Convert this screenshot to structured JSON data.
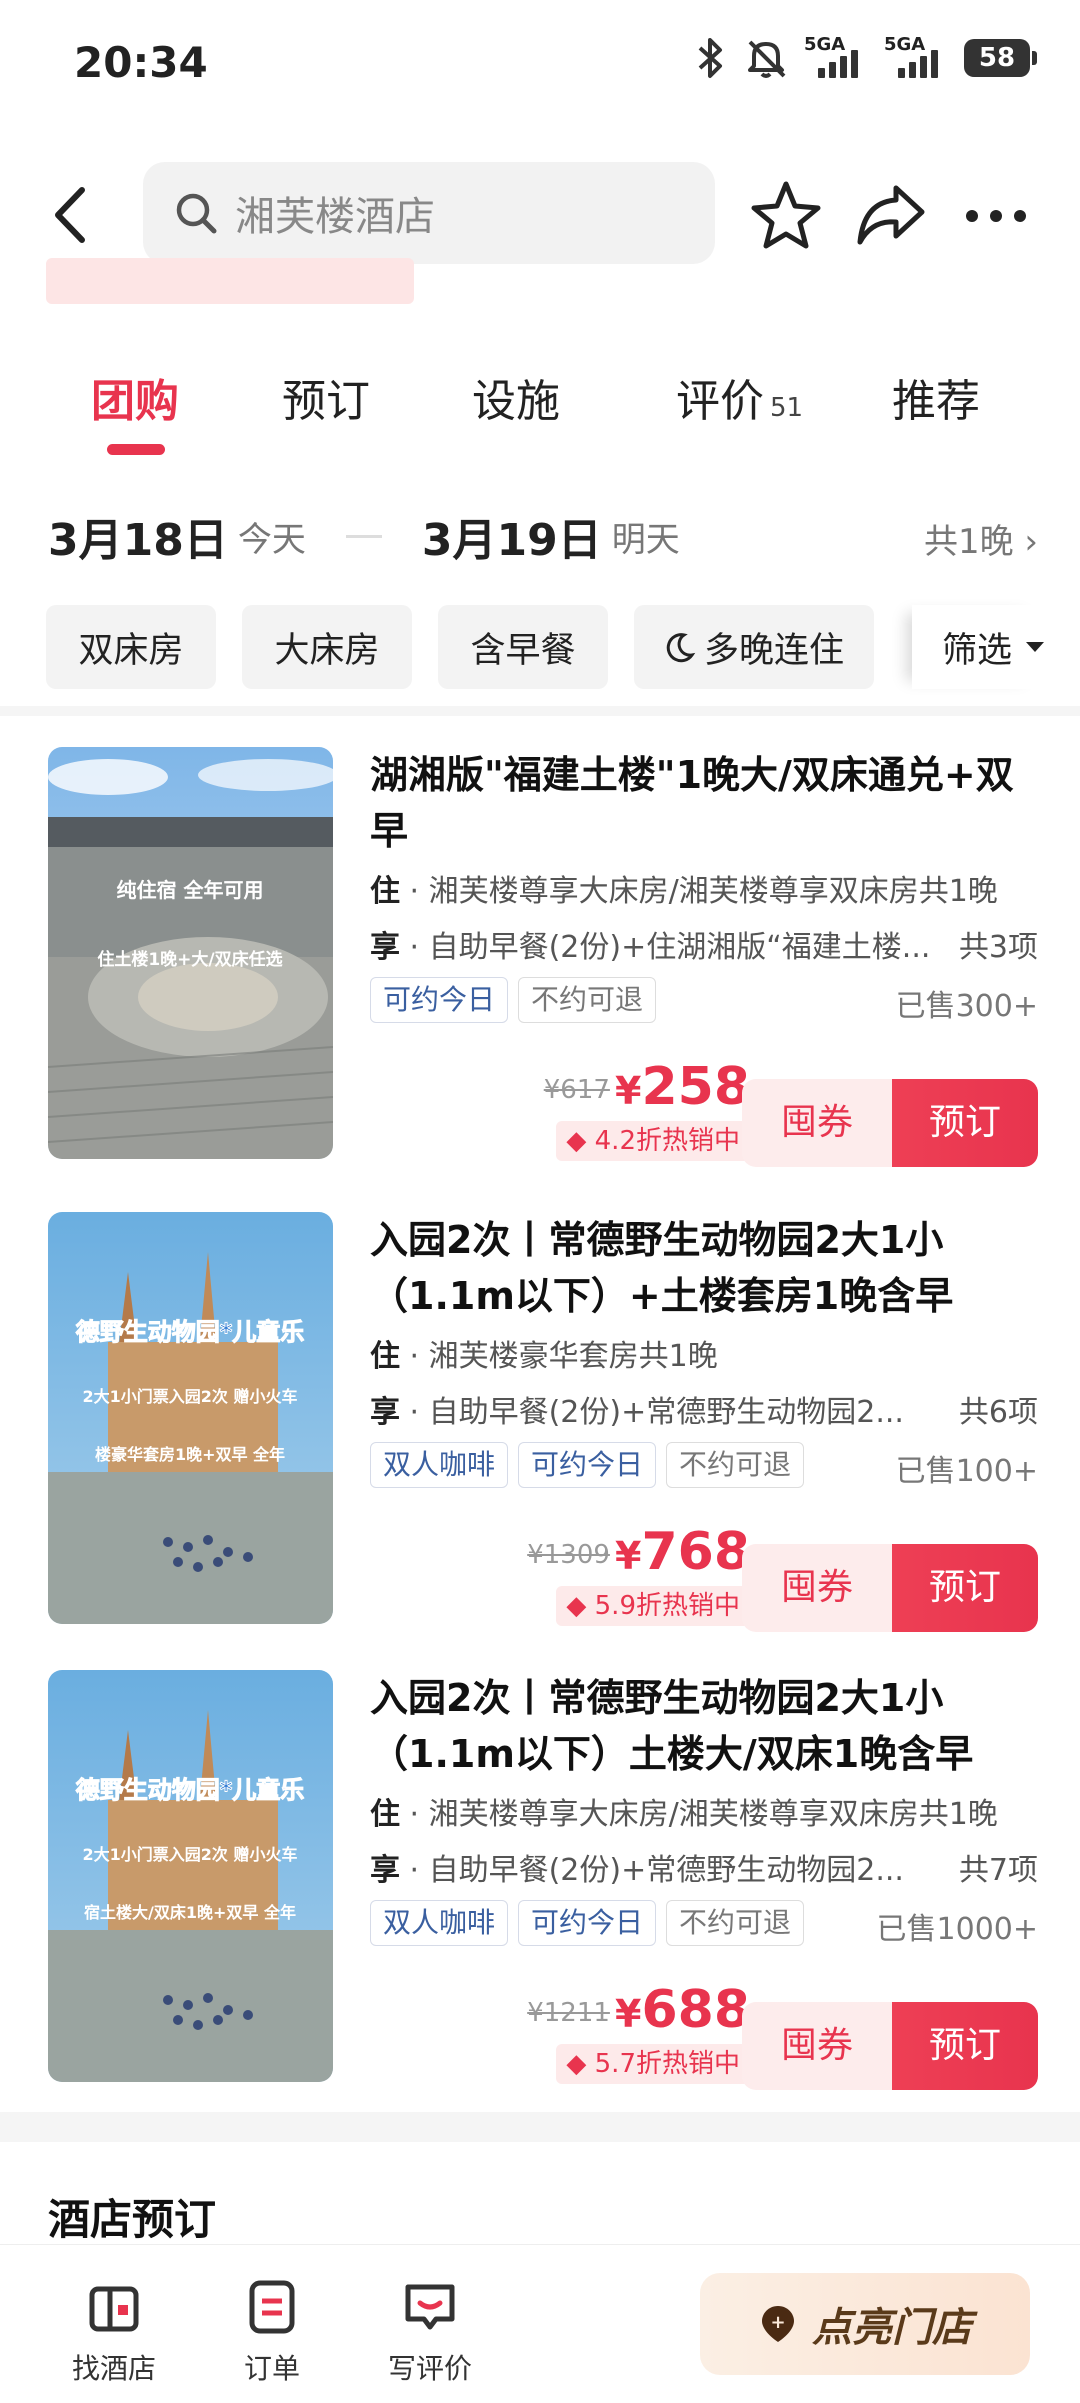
{
  "status_bar": {
    "time": "20:34",
    "signal1": "5GA",
    "signal2": "5GA",
    "battery": "58"
  },
  "header": {
    "search_placeholder": "湘芙楼酒店"
  },
  "tabs": [
    {
      "label": "团购"
    },
    {
      "label": "预订"
    },
    {
      "label": "设施"
    },
    {
      "label": "评价",
      "count": "51"
    },
    {
      "label": "推荐"
    }
  ],
  "dates": {
    "checkin": "3月18日",
    "checkin_sub": "今天",
    "checkout": "3月19日",
    "checkout_sub": "明天",
    "nights": "共1晚"
  },
  "filters": {
    "chips": [
      "双床房",
      "大床房",
      "含早餐",
      "多晚连住"
    ],
    "filter_label": "筛选"
  },
  "deals": [
    {
      "title": "湖湘版\"福建土楼\"1晚大/双床通兑+双早",
      "stay_label": "住",
      "stay": " · 湘芙楼尊享大床房/湘芙楼尊享双床房共1晚",
      "perk_label": "享",
      "perk": " · 自助早餐(2份)+住湖湘版“福建土楼...",
      "perk_count": "共3项",
      "tags": [
        "可约今日",
        "不约可退"
      ],
      "sold": "已售300+",
      "old_price": "¥617",
      "currency": "¥",
      "price": "258",
      "discount": "4.2折热销中",
      "btn_coupon": "囤券",
      "btn_book": "预订",
      "thumb_text1": "纯住宿  全年可用",
      "thumb_text2": "住土楼1晚+大/双床任选"
    },
    {
      "title": "入园2次丨常德野生动物园2大1小（1.1m以下）+土楼套房1晚含早+含…",
      "stay_label": "住",
      "stay": " · 湘芙楼豪华套房共1晚",
      "perk_label": "享",
      "perk": " · 自助早餐(2份)+常德野生动物园2...",
      "perk_count": "共6项",
      "tags": [
        "双人咖啡",
        "可约今日",
        "不约可退"
      ],
      "sold": "已售100+",
      "old_price": "¥1309",
      "currency": "¥",
      "price": "768",
      "discount": "5.9折热销中",
      "btn_coupon": "囤券",
      "btn_book": "预订",
      "thumb_text1": "德野生动物园*儿童乐",
      "thumb_text2": "2大1小门票入园2次 赠小火车",
      "thumb_text3": "楼豪华套房1晚+双早  全年"
    },
    {
      "title": "入园2次丨常德野生动物园2大1小（1.1m以下）土楼大/双床1晚含早+小…",
      "stay_label": "住",
      "stay": " · 湘芙楼尊享大床房/湘芙楼尊享双床房共1晚",
      "perk_label": "享",
      "perk": " · 自助早餐(2份)+常德野生动物园2...",
      "perk_count": "共7项",
      "tags": [
        "双人咖啡",
        "可约今日",
        "不约可退"
      ],
      "sold": "已售1000+",
      "old_price": "¥1211",
      "currency": "¥",
      "price": "688",
      "discount": "5.7折热销中",
      "btn_coupon": "囤券",
      "btn_book": "预订",
      "thumb_text1": "德野生动物园*儿童乐",
      "thumb_text2": "2大1小门票入园2次 赠小火车",
      "thumb_text3": "宿土楼大/双床1晚+双早  全年"
    }
  ],
  "section_title": "酒店预订",
  "bottom_nav": {
    "find_hotel": "找酒店",
    "orders": "订单",
    "review": "写评价",
    "light_store": "点亮门店"
  },
  "colors": {
    "accent": "#e8344e",
    "tag_blue": "#3a5fa0"
  }
}
